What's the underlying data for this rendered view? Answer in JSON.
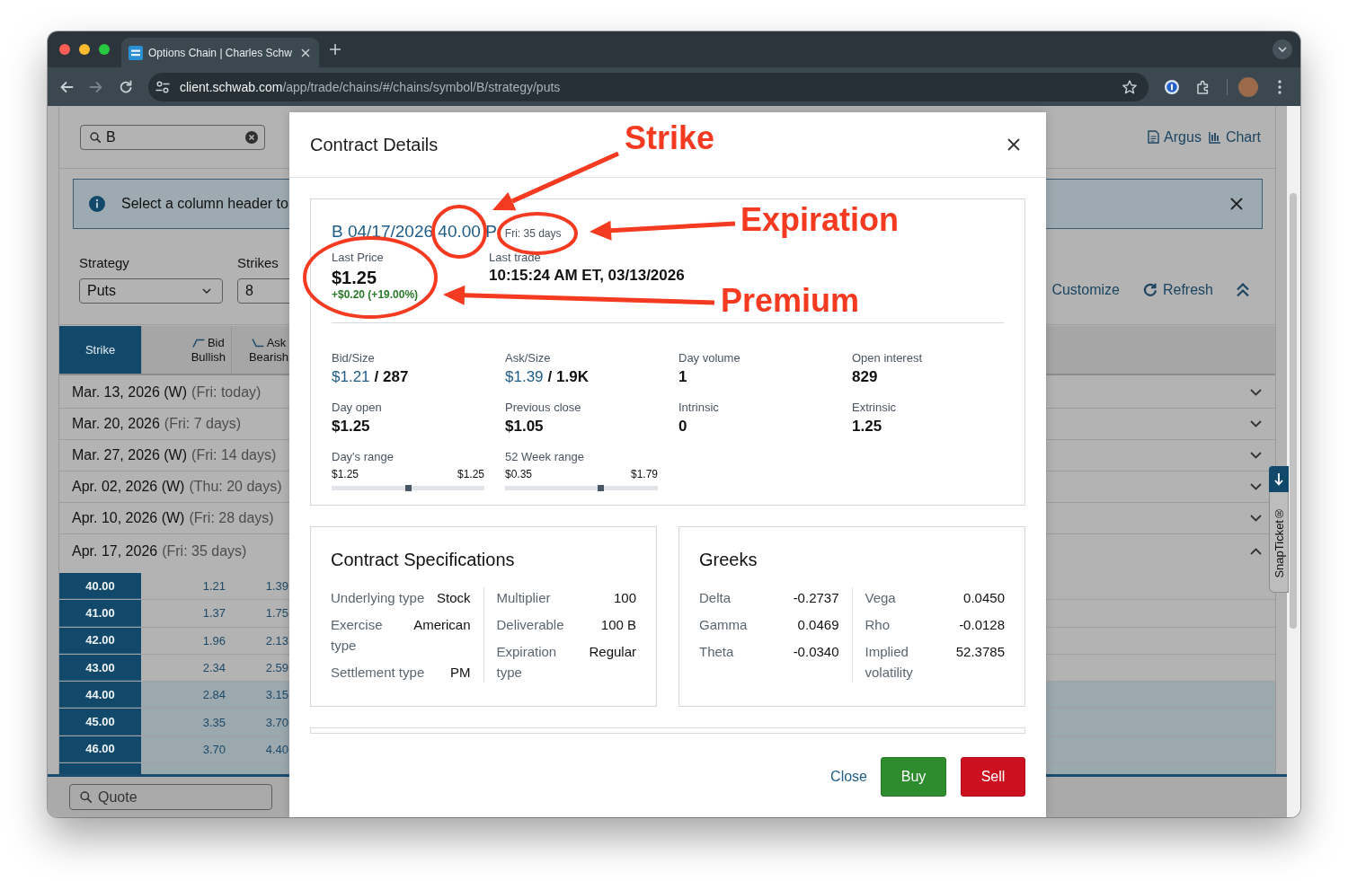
{
  "browser": {
    "tabs": [
      {
        "title": "Options Chain | Charles Schw",
        "selected": true
      }
    ],
    "nav_buttons": [
      {
        "kind": "back",
        "disabled": false
      },
      {
        "kind": "forward",
        "disabled": true
      },
      {
        "kind": "reload",
        "disabled": false
      }
    ],
    "address": {
      "host": "client.schwab.com",
      "path": "/app/trade/chains/#/chains/symbol/B/strategy/puts"
    }
  },
  "page": {
    "search": {
      "value": "B"
    },
    "links": [
      {
        "kind": "document",
        "label": "Argus"
      },
      {
        "kind": "chart",
        "label": "Chart"
      }
    ],
    "banner": {
      "text": "Select a column header to"
    },
    "filters": [
      {
        "kind": "select",
        "label": "Strategy",
        "value": "Puts"
      },
      {
        "kind": "input",
        "label": "Strikes",
        "value": "8"
      }
    ],
    "actions": [
      {
        "kind": "gear",
        "label": "Customize"
      },
      {
        "kind": "refresh",
        "label": "Refresh"
      }
    ],
    "columns": [
      {
        "kind": "strike",
        "label": "Strike"
      },
      {
        "kind": "bullish",
        "label": "Bid",
        "sublabel": "Bullish"
      },
      {
        "kind": "bearish",
        "label": "Ask",
        "sublabel": "Bearish"
      }
    ],
    "expirations": [
      {
        "date": "Mar. 13, 2026 (W)",
        "note": "(Fri: today)",
        "expanded": false
      },
      {
        "date": "Mar. 20, 2026",
        "note": "(Fri: 7 days)",
        "expanded": false
      },
      {
        "date": "Mar. 27, 2026 (W)",
        "note": "(Fri: 14 days)",
        "expanded": false
      },
      {
        "date": "Apr. 02, 2026 (W)",
        "note": "(Thu: 20 days)",
        "expanded": false
      },
      {
        "date": "Apr. 10, 2026 (W)",
        "note": "(Fri: 28 days)",
        "expanded": false
      },
      {
        "date": "Apr. 17, 2026",
        "note": "(Fri: 35 days)",
        "expanded": true
      }
    ],
    "rows": [
      {
        "strike": "40.00",
        "bid": "1.21",
        "ask": "1.39",
        "in_the_money": false
      },
      {
        "strike": "41.00",
        "bid": "1.37",
        "ask": "1.75",
        "in_the_money": false
      },
      {
        "strike": "42.00",
        "bid": "1.96",
        "ask": "2.13",
        "in_the_money": false
      },
      {
        "strike": "43.00",
        "bid": "2.34",
        "ask": "2.59",
        "in_the_money": false
      },
      {
        "strike": "44.00",
        "bid": "2.84",
        "ask": "3.15",
        "in_the_money": true
      },
      {
        "strike": "45.00",
        "bid": "3.35",
        "ask": "3.70",
        "in_the_money": true
      },
      {
        "strike": "46.00",
        "bid": "3.70",
        "ask": "4.40",
        "in_the_money": true
      },
      {
        "in_the_money": true
      }
    ],
    "quote": {
      "placeholder": "Quote"
    },
    "snapticket": {
      "label": "SnapTicket®"
    }
  },
  "modal": {
    "title": "Contract Details",
    "contract": {
      "symbol": "B 04/17/2026 40.00 P",
      "note": "Fri: 35 days"
    },
    "last_price": {
      "label": "Last Price",
      "value": "$1.25",
      "change": "+$0.20 (+19.00%)"
    },
    "last_trade": {
      "label": "Last trade",
      "value": "10:15:24 AM ET, 03/13/2026"
    },
    "stats": [
      {
        "kind": "quote",
        "label": "Bid/Size",
        "price": "$1.21",
        "size": "/ 287"
      },
      {
        "kind": "quote",
        "label": "Ask/Size",
        "price": "$1.39",
        "size": "/ 1.9K"
      },
      {
        "kind": "value",
        "label": "Day volume",
        "value": "1"
      },
      {
        "kind": "value",
        "label": "Open interest",
        "value": "829"
      },
      {
        "kind": "value",
        "label": "Day open",
        "value": "$1.25"
      },
      {
        "kind": "value",
        "label": "Previous close",
        "value": "$1.05"
      },
      {
        "kind": "value",
        "label": "Intrinsic",
        "value": "0"
      },
      {
        "kind": "value",
        "label": "Extrinsic",
        "value": "1.25"
      },
      {
        "kind": "range",
        "label": "Day's range",
        "low": "$1.25",
        "high": "$1.25",
        "level": 0.5
      },
      {
        "kind": "range",
        "label": "52 Week range",
        "low": "$0.35",
        "high": "$1.79",
        "level": 0.625
      }
    ],
    "cards": [
      {
        "title": "Contract Specifications",
        "columns": [
          [
            {
              "label": "Underlying type",
              "value": "Stock"
            },
            {
              "label": "Exercise type",
              "value": "American"
            },
            {
              "label": "Settlement type",
              "value": "PM"
            }
          ],
          [
            {
              "label": "Multiplier",
              "value": "100"
            },
            {
              "label": "Deliverable",
              "value": "100 B"
            },
            {
              "label": "Expiration type",
              "value": "Regular"
            }
          ]
        ]
      },
      {
        "title": "Greeks",
        "columns": [
          [
            {
              "label": "Delta",
              "value": "-0.2737"
            },
            {
              "label": "Gamma",
              "value": "0.0469"
            },
            {
              "label": "Theta",
              "value": "-0.0340"
            }
          ],
          [
            {
              "label": "Vega",
              "value": "0.0450"
            },
            {
              "label": "Rho",
              "value": "-0.0128"
            },
            {
              "label": "Implied volatility",
              "value": "52.3785"
            }
          ]
        ]
      }
    ],
    "buttons": [
      {
        "kind": "link",
        "label": "Close"
      },
      {
        "kind": "buy",
        "label": "Buy"
      },
      {
        "kind": "sell",
        "label": "Sell"
      }
    ]
  },
  "annotations": [
    {
      "text": "Strike"
    },
    {
      "text": "Expiration"
    },
    {
      "text": "Premium"
    }
  ]
}
